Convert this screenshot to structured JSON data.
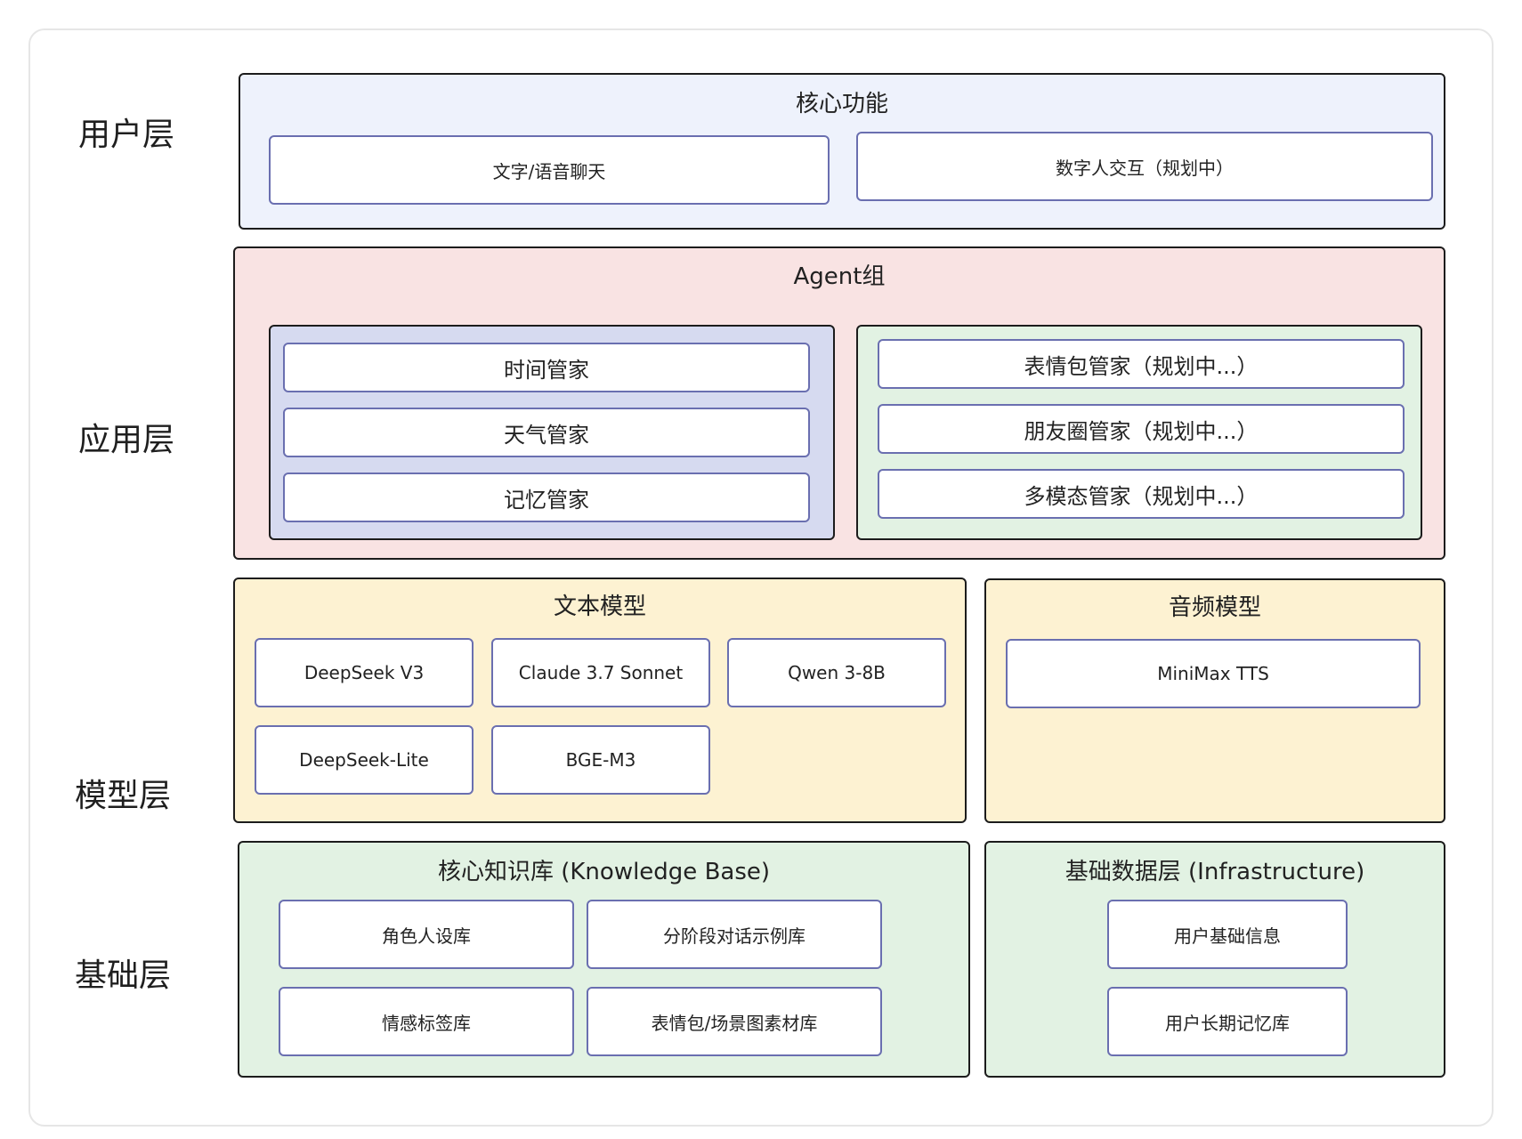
{
  "layers": {
    "user": "用户层",
    "app": "应用层",
    "model": "模型层",
    "base": "基础层"
  },
  "user_layer": {
    "title": "核心功能",
    "items": [
      "文字/语音聊天",
      "数字人交互（规划中）"
    ]
  },
  "app_layer": {
    "title": "Agent组",
    "left_group": [
      "时间管家",
      "天气管家",
      "记忆管家"
    ],
    "right_group": [
      "表情包管家（规划中...）",
      "朋友圈管家（规划中...）",
      "多模态管家（规划中...）"
    ]
  },
  "model_layer": {
    "text_title": "文本模型",
    "text_models": [
      "DeepSeek V3",
      "Claude 3.7 Sonnet",
      "Qwen 3-8B",
      "DeepSeek-Lite",
      "BGE-M3"
    ],
    "audio_title": "音频模型",
    "audio_models": [
      "MiniMax TTS"
    ]
  },
  "base_layer": {
    "kb_title": "核心知识库 (Knowledge Base)",
    "kb_items": [
      "角色人设库",
      "分阶段对话示例库",
      "情感标签库",
      "表情包/场景图素材库"
    ],
    "infra_title": "基础数据层 (Infrastructure)",
    "infra_items": [
      "用户基础信息",
      "用户长期记忆库"
    ]
  }
}
